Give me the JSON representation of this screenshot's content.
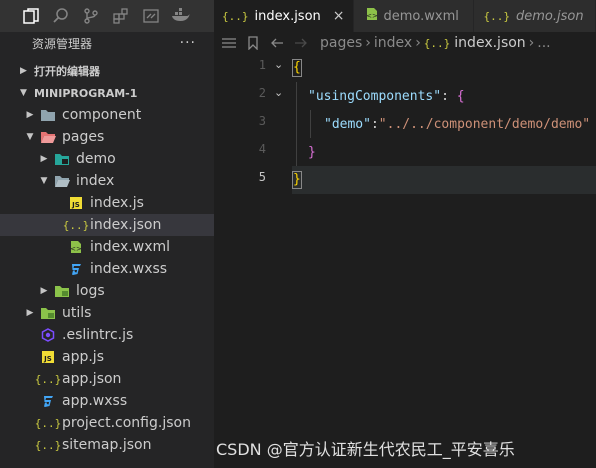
{
  "explorer": {
    "title": "资源管理器",
    "more": "···",
    "open_editors": "打开的编辑器",
    "project": "MINIPROGRAM-1"
  },
  "tree": [
    {
      "label": "component",
      "icon": "folder-icon",
      "depth": 1,
      "twisty": "›"
    },
    {
      "label": "pages",
      "icon": "folder-open-red-icon",
      "depth": 1,
      "twisty": "⌄"
    },
    {
      "label": "demo",
      "icon": "folder-teal-icon",
      "depth": 2,
      "twisty": "›"
    },
    {
      "label": "index",
      "icon": "folder-open-icon",
      "depth": 2,
      "twisty": "⌄"
    },
    {
      "label": "index.js",
      "icon": "js-file-icon",
      "depth": 3,
      "twisty": ""
    },
    {
      "label": "index.json",
      "icon": "json-file-icon",
      "depth": 3,
      "twisty": "",
      "selected": true
    },
    {
      "label": "index.wxml",
      "icon": "wxml-file-icon",
      "depth": 3,
      "twisty": ""
    },
    {
      "label": "index.wxss",
      "icon": "css-file-icon",
      "depth": 3,
      "twisty": ""
    },
    {
      "label": "logs",
      "icon": "folder-green-icon",
      "depth": 2,
      "twisty": "›"
    },
    {
      "label": "utils",
      "icon": "folder-green-icon",
      "depth": 1,
      "twisty": "›"
    },
    {
      "label": ".eslintrc.js",
      "icon": "eslint-icon",
      "depth": 1,
      "twisty": ""
    },
    {
      "label": "app.js",
      "icon": "js-file-icon",
      "depth": 1,
      "twisty": ""
    },
    {
      "label": "app.json",
      "icon": "json-file-icon",
      "depth": 1,
      "twisty": ""
    },
    {
      "label": "app.wxss",
      "icon": "css-file-icon",
      "depth": 1,
      "twisty": ""
    },
    {
      "label": "project.config.json",
      "icon": "json-file-icon",
      "depth": 1,
      "twisty": ""
    },
    {
      "label": "sitemap.json",
      "icon": "json-file-icon",
      "depth": 1,
      "twisty": ""
    }
  ],
  "tabs": [
    {
      "label": "index.json",
      "active": true,
      "close": "×"
    },
    {
      "label": "demo.wxml",
      "active": false
    },
    {
      "label": "demo.json",
      "active": false,
      "italic": true
    }
  ],
  "breadcrumb": {
    "parts": [
      "pages",
      "index"
    ],
    "current": "index.json",
    "tail": "..."
  },
  "line_numbers": [
    "1",
    "2",
    "3",
    "4",
    "5"
  ],
  "code": {
    "line1": "{",
    "line2_key": "\"usingComponents\"",
    "line2_punc": ": ",
    "line2_brace": "{",
    "line3_key": "\"demo\"",
    "line3_punc": ":",
    "line3_val": "\"../../component/demo/demo\"",
    "line4": "}",
    "line5": "}"
  },
  "watermark": "CSDN @官方认证新生代农民工_平安喜乐",
  "colors": {
    "sidebar_bg": "#252526",
    "editor_bg": "#1e1e1e",
    "selection": "#37373d",
    "json_icon": "#cbcb41",
    "key": "#9cdcfe",
    "string": "#ce9178"
  }
}
